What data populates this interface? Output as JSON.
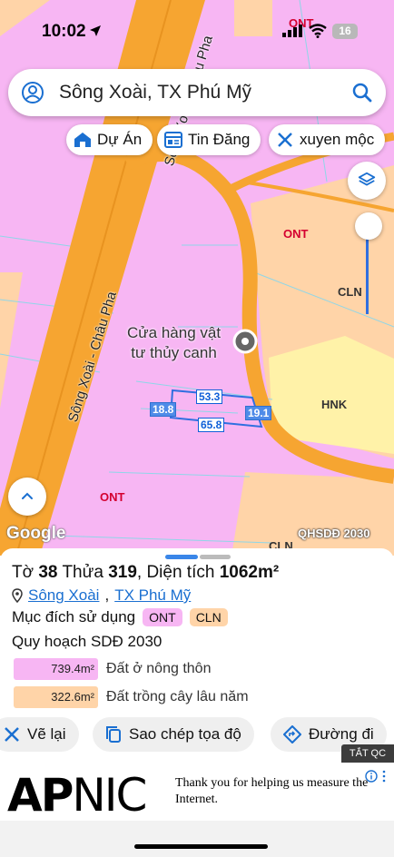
{
  "status": {
    "time": "10:02",
    "battery": "16"
  },
  "search": {
    "value": "Sông Xoài, TX Phú Mỹ",
    "placeholder": "Sông Xoài, TX Phú Mỹ"
  },
  "chips": [
    {
      "label": "Dự Án",
      "icon": "house-icon"
    },
    {
      "label": "Tin Đăng",
      "icon": "listing-icon"
    },
    {
      "label": "xuyen mộc",
      "icon": "tools-icon"
    }
  ],
  "map": {
    "zones": [
      "ONT",
      "ONT",
      "CLN",
      "HNK",
      "ONT",
      "CLN"
    ],
    "roads": [
      "Sông Xoài - Châu Pha",
      "Sông Xoài - Châu Pha"
    ],
    "poi": {
      "line1": "Cửa hàng vật",
      "line2": "tư thủy canh"
    },
    "dimensions": {
      "top": "53.3",
      "left": "18.8",
      "bottom": "65.8",
      "right": "19.1"
    },
    "attribution": "Google",
    "layer_tag": "QHSDĐ 2030"
  },
  "parcel": {
    "sheet_label": "Tờ",
    "sheet": "38",
    "plot_label": "Thửa",
    "plot": "319",
    "area_label": "Diện tích",
    "area": "1062m²",
    "ward": "Sông Xoài",
    "town": "TX Phú Mỹ",
    "purpose_label": "Mục đích sử dụng",
    "purposes": [
      "ONT",
      "CLN"
    ],
    "plan_label": "Quy hoạch SDĐ 2030",
    "breakdown": [
      {
        "value": "739.4m²",
        "label": "Đất ở nông thôn",
        "color": "#f7b6f3"
      },
      {
        "value": "322.6m²",
        "label": "Đất trồng cây lâu năm",
        "color": "#ffd4a8"
      }
    ]
  },
  "actions": {
    "redraw": "Vẽ lại",
    "copy": "Sao chép tọa độ",
    "directions": "Đường đi"
  },
  "ad": {
    "close_label": "TẮT QC",
    "logo_bold": "AP",
    "logo_light": "NIC",
    "text": "Thank you for helping us measure the Internet."
  },
  "colors": {
    "accent": "#1a6fd1",
    "ont": "#f7b6f3",
    "cln": "#ffd4a8",
    "hnk": "#fff2a8",
    "road": "#f6a531"
  }
}
